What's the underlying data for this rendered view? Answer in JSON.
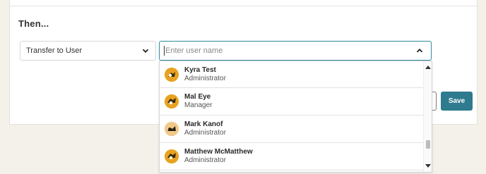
{
  "section": {
    "then_label": "Then..."
  },
  "action_select": {
    "value": "Transfer to User"
  },
  "user_input": {
    "value": "",
    "placeholder": "Enter user name"
  },
  "buttons": {
    "save_label": "Save"
  },
  "dropdown": {
    "items": [
      {
        "name": "Kyra Test",
        "role": "Administrator"
      },
      {
        "name": "Mal Eye",
        "role": "Manager"
      },
      {
        "name": "Mark Kanof",
        "role": "Administrator"
      },
      {
        "name": "Matthew McMatthew",
        "role": "Administrator"
      }
    ]
  },
  "colors": {
    "accent": "#2e7a8e",
    "input_focus": "#2f8aa0",
    "avatar": "#e7a21f",
    "background": "#f4f0ea"
  },
  "icons": {
    "select_chevron": "chevron-down-icon",
    "input_chevron": "chevron-up-icon",
    "avatar_icon": "user-avatar-icon"
  }
}
